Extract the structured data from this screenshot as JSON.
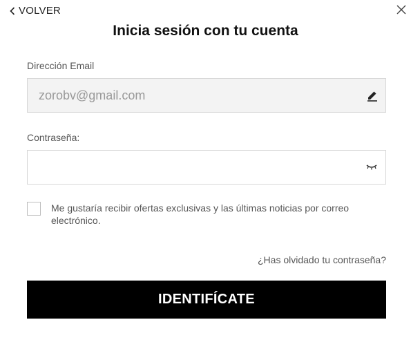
{
  "header": {
    "back_label": "VOLVER",
    "title": "Inicia sesión con tu cuenta"
  },
  "email": {
    "label": "Dirección Email",
    "value": "zorobv@gmail.com"
  },
  "password": {
    "label": "Contraseña:",
    "value": ""
  },
  "newsletter": {
    "checked": false,
    "text": "Me gustaría recibir ofertas exclusivas y las últimas noticias por correo electrónico."
  },
  "links": {
    "forgot": "¿Has olvidado tu contraseña?"
  },
  "actions": {
    "submit_label": "IDENTIFÍCATE"
  },
  "icons": {
    "back": "chevron-left-icon",
    "close": "close-icon",
    "edit": "pencil-icon",
    "visibility": "eye-closed-icon"
  }
}
